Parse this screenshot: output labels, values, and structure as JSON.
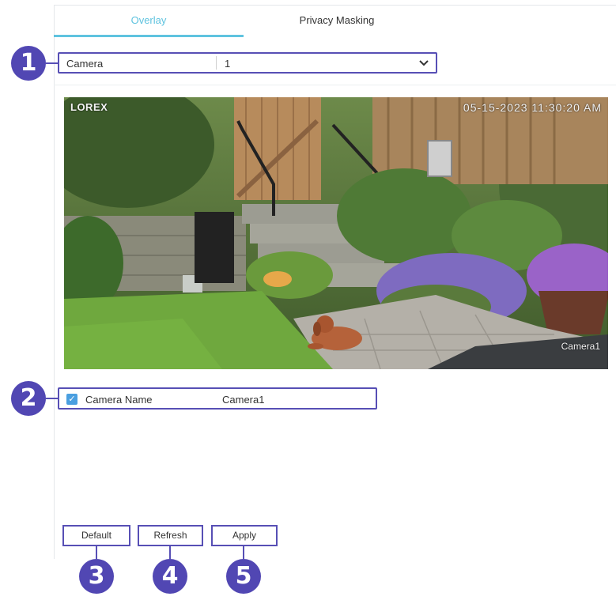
{
  "tabs": [
    {
      "label": "Overlay",
      "active": true
    },
    {
      "label": "Privacy Masking",
      "active": false
    }
  ],
  "camera_select": {
    "label": "Camera",
    "value": "1",
    "icon": "chevron-down-icon"
  },
  "preview": {
    "logo": "LOREX",
    "timestamp": "05-15-2023 11:30:20 AM",
    "camera_name_overlay": "Camera1"
  },
  "camera_name_row": {
    "checked": true,
    "label": "Camera Name",
    "value": "Camera1"
  },
  "buttons": {
    "default_label": "Default",
    "refresh_label": "Refresh",
    "apply_label": "Apply"
  },
  "callouts": [
    "1",
    "2",
    "3",
    "4",
    "5"
  ],
  "colors": {
    "accent": "#5fc3df",
    "callout": "#574fb5",
    "badge": "#5147b3",
    "checkbox": "#4a9fe0"
  }
}
